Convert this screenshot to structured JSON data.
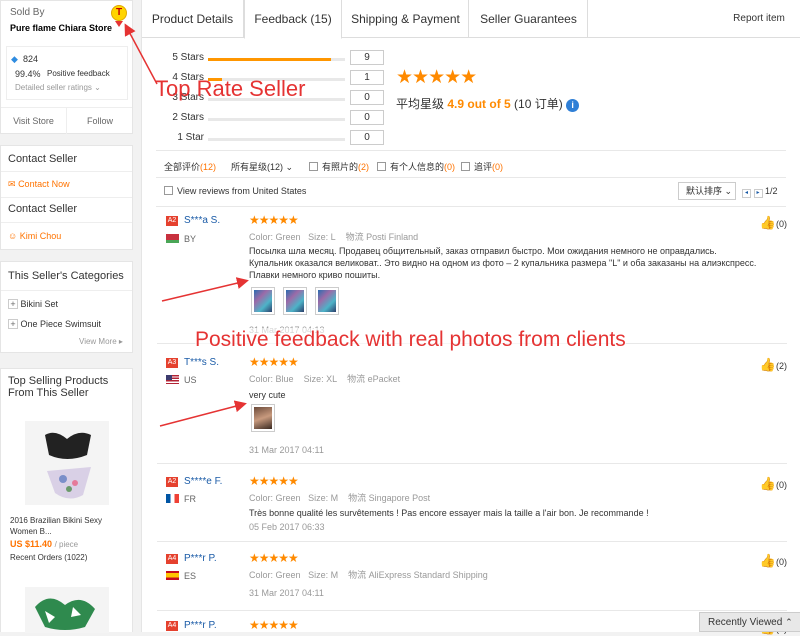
{
  "seller": {
    "sold_by_label": "Sold By",
    "store_name": "Pure flame Chiara Store",
    "badge_letter": "T",
    "score": "824",
    "positive_pct": "99.4%",
    "positive_label": "Positive feedback",
    "detailed_ratings": "Detailed seller ratings",
    "visit_store": "Visit Store",
    "follow": "Follow"
  },
  "contact": {
    "title": "Contact Seller",
    "contact_now": "Contact Now",
    "title2": "Contact Seller",
    "person": "Kimi Chou"
  },
  "categories": {
    "title": "This Seller's Categories",
    "items": [
      "Bikini Set",
      "One Piece Swimsuit"
    ],
    "view_more": "View More"
  },
  "top_selling": {
    "title_line1": "Top Selling Products",
    "title_line2": "From This Seller",
    "product_name_line1": "2016 Brazilian Bikini Sexy",
    "product_name_line2": "Women B...",
    "price": "US $11.40",
    "price_unit": "/ piece",
    "orders": "Recent Orders (1022)"
  },
  "tabs": {
    "product_details": "Product Details",
    "feedback": "Feedback (15)",
    "shipping": "Shipping & Payment",
    "guarantees": "Seller Guarantees",
    "report": "Report item"
  },
  "rating": {
    "rows": [
      {
        "label": "5 Stars",
        "count": "9",
        "fraction": 0.9
      },
      {
        "label": "4 Stars",
        "count": "1",
        "fraction": 0.1
      },
      {
        "label": "3 Stars",
        "count": "0",
        "fraction": 0
      },
      {
        "label": "2 Stars",
        "count": "0",
        "fraction": 0
      },
      {
        "label": "1 Star",
        "count": "0",
        "fraction": 0
      }
    ],
    "big_stars": "★★★★★",
    "avg_prefix": "平均星级",
    "avg_value": "4.9 out of 5",
    "avg_orders": "(10 订单)"
  },
  "filters": {
    "all_label": "全部评价",
    "all_count": "(12)",
    "stars_label": "所有星级",
    "stars_count": "(12)",
    "photo_label": "有照片的",
    "photo_count": "(2)",
    "personal_label": "有个人信息的",
    "personal_count": "(0)",
    "append_label": "追评",
    "append_count": "(0)",
    "us_label": "View reviews from United States",
    "sort_label": "默认排序",
    "page": "1/2"
  },
  "reviews": [
    {
      "badge": "A2",
      "name": "S***a S.",
      "country": "BY",
      "color_label": "Color:",
      "color": "Green",
      "size_label": "Size:",
      "size": "L",
      "ship_label": "物流",
      "ship": "Posti Finland",
      "text": "Посылка шла месяц. Продавец общительный, заказ отправил быстро. Мои ожидания немного не оправдались. Купальник оказался великоват.. Это видно на одном из фото – 2 купальника размера \"L\" и оба заказаны на алиэкспресс. Плавки немного криво пошиты.",
      "date": "31 Mar 2017 04:13",
      "likes": "(0)"
    },
    {
      "badge": "A3",
      "name": "T***s S.",
      "country": "US",
      "color_label": "Color:",
      "color": "Blue",
      "size_label": "Size:",
      "size": "XL",
      "ship_label": "物流",
      "ship": "ePacket",
      "text": "very cute",
      "date": "31 Mar 2017 04:11",
      "likes": "(2)"
    },
    {
      "badge": "A2",
      "name": "S****e F.",
      "country": "FR",
      "color_label": "Color:",
      "color": "Green",
      "size_label": "Size:",
      "size": "M",
      "ship_label": "物流",
      "ship": "Singapore Post",
      "text": "Très bonne qualité les survêtements ! Pas encore essayer mais la taille a l'air bon. Je recommande !",
      "date": "05 Feb 2017 06:33",
      "likes": "(0)"
    },
    {
      "badge": "A4",
      "name": "P***r P.",
      "country": "ES",
      "color_label": "Color:",
      "color": "Green",
      "size_label": "Size:",
      "size": "M",
      "ship_label": "物流",
      "ship": "AliExpress Standard Shipping",
      "text": "",
      "date": "31 Mar 2017 04:11",
      "likes": "(0)"
    },
    {
      "badge": "A4",
      "name": "P***r P.",
      "country": "",
      "likes": "(0)"
    }
  ],
  "annotations": {
    "top_rate": "Top Rate Seller",
    "positive": "Positive feedback with real photos from clients"
  },
  "recently_viewed": "Recently Viewed"
}
